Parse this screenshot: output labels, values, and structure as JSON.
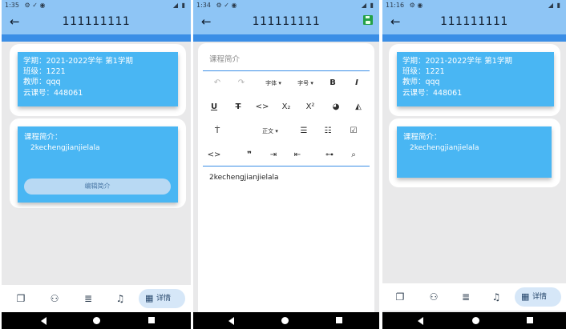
{
  "screens": [
    {
      "status": {
        "time": "1:35",
        "icons_left": "⚙ ✓ ◉",
        "icons_right": "◢ ▮"
      },
      "title": "111111111",
      "info": {
        "term": "学期：2021-2022学年 第1学期",
        "class": "班级：1221",
        "teacher": "教师：qqq",
        "code": "云课号：448061"
      },
      "intro": {
        "label": "课程简介：",
        "text": "2kechengjianjielala",
        "edit_button": "编辑简介"
      },
      "nav": {
        "active_label": "详情"
      }
    },
    {
      "status": {
        "time": "1:34",
        "icons_left": "⚙ ✓ ◉",
        "icons_right": "◢ ▮"
      },
      "title": "111111111",
      "editor": {
        "placeholder": "课程简介",
        "font_label": "字体 ▾",
        "size_label": "字号 ▾",
        "para_label": "正文 ▾",
        "content": "2kechengjianjielala"
      }
    },
    {
      "status": {
        "time": "11:16",
        "icons_left": "⚙ ◉",
        "icons_right": "◢ ▮"
      },
      "title": "111111111",
      "info": {
        "term": "学期：2021-2022学年 第1学期",
        "class": "班级：1221",
        "teacher": "教师：qqq",
        "code": "云课号：448061"
      },
      "intro": {
        "label": "课程简介：",
        "text": "2kechengjianjielala"
      },
      "nav": {
        "active_label": "详情"
      }
    }
  ],
  "colors": {
    "appbar": "#8ec5f5",
    "band": "#3a8ee6",
    "card_blue": "#49b6f3",
    "save": "#24a146"
  },
  "icons": [
    "back-arrow-icon",
    "save-icon",
    "library-icon",
    "add-person-icon",
    "list-icon",
    "bell-icon",
    "details-icon"
  ]
}
